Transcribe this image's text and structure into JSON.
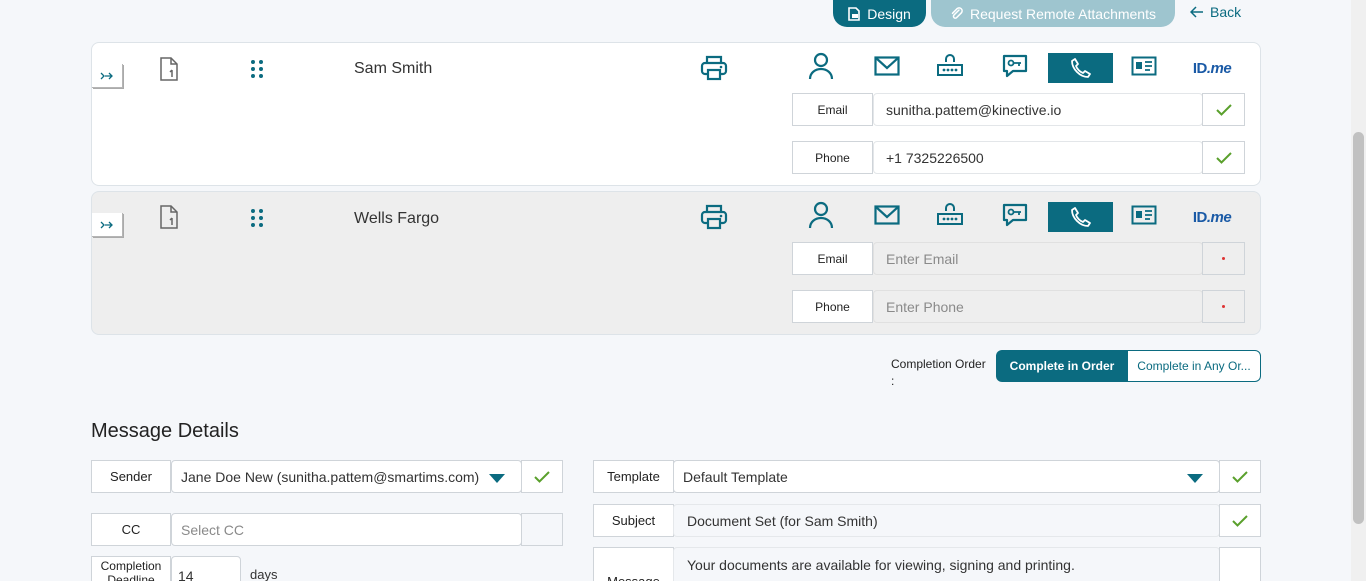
{
  "toolbar": {
    "design_label": "Design",
    "remote_label": "Request Remote Attachments",
    "back_label": "Back"
  },
  "signers": [
    {
      "name": "Sam Smith",
      "email_label": "Email",
      "email_value": "sunitha.pattem@kinective.io",
      "phone_label": "Phone",
      "phone_value": "+1 7325226500"
    },
    {
      "name": "Wells Fargo",
      "email_label": "Email",
      "email_placeholder": "Enter Email",
      "phone_label": "Phone",
      "phone_placeholder": "Enter Phone"
    }
  ],
  "idme": {
    "id": "ID",
    "me": ".me"
  },
  "completion": {
    "label": "Completion Order",
    "colon": ":",
    "in_order": "Complete in Order",
    "any_order": "Complete in Any Or..."
  },
  "message": {
    "title": "Message Details",
    "sender_label": "Sender",
    "sender_value": "Jane Doe New (sunitha.pattem@smartims.com)",
    "cc_label": "CC",
    "cc_placeholder": "Select CC",
    "deadline_label": "Completion Deadline",
    "deadline_value": "14",
    "deadline_unit": "days",
    "template_label": "Template",
    "template_value": "Default Template",
    "subject_label": "Subject",
    "subject_value": "Document Set (for Sam Smith)",
    "message_label": "Message",
    "message_value": "Your documents are available for viewing, signing and printing."
  },
  "colors": {
    "accent": "#0b6b80",
    "check": "#5aa02c",
    "idme": "#1a5aa6"
  }
}
